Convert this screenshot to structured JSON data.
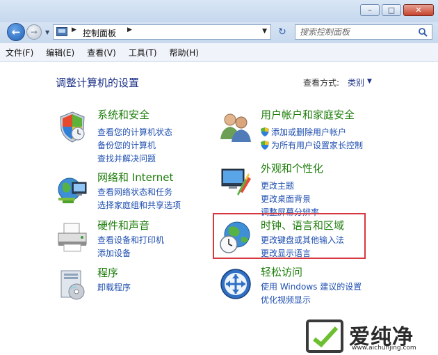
{
  "window": {
    "controls": {
      "minimize": "–",
      "maximize": "□",
      "close": "✕"
    }
  },
  "address_bar": {
    "back_glyph": "←",
    "forward_glyph": "→",
    "breadcrumb": [
      "控制面板"
    ],
    "refresh_glyph": "↻"
  },
  "search": {
    "placeholder": "搜索控制面板"
  },
  "menu": [
    "文件(F)",
    "编辑(E)",
    "查看(V)",
    "工具(T)",
    "帮助(H)"
  ],
  "page": {
    "title": "调整计算机的设置",
    "view_by_label": "查看方式:",
    "view_by_value": "类别"
  },
  "categories": [
    {
      "title": "系统和安全",
      "icon": "shield-icon",
      "links": [
        "查看您的计算机状态",
        "备份您的计算机",
        "查找并解决问题"
      ]
    },
    {
      "title": "网络和 Internet",
      "icon": "network-globe-icon",
      "links": [
        "查看网络状态和任务",
        "选择家庭组和共享选项"
      ]
    },
    {
      "title": "硬件和声音",
      "icon": "printer-icon",
      "links": [
        "查看设备和打印机",
        "添加设备"
      ]
    },
    {
      "title": "程序",
      "icon": "programs-icon",
      "links": [
        "卸载程序"
      ]
    },
    {
      "title": "用户帐户和家庭安全",
      "icon": "users-icon",
      "links": [
        "添加或删除用户帐户",
        "为所有用户设置家长控制"
      ]
    },
    {
      "title": "外观和个性化",
      "icon": "monitor-paint-icon",
      "links": [
        "更改主题",
        "更改桌面背景",
        "调整屏幕分辨率"
      ]
    },
    {
      "title": "时钟、语言和区域",
      "icon": "globe-clock-icon",
      "links": [
        "更改键盘或其他输入法",
        "更改显示语言"
      ]
    },
    {
      "title": "轻松访问",
      "icon": "ease-of-access-icon",
      "links": [
        "使用 Windows 建议的设置",
        "优化视频显示"
      ]
    }
  ],
  "highlight_color": "#d6383f",
  "watermark": {
    "text": "爱纯净",
    "url": "www.aichunjing.com"
  }
}
